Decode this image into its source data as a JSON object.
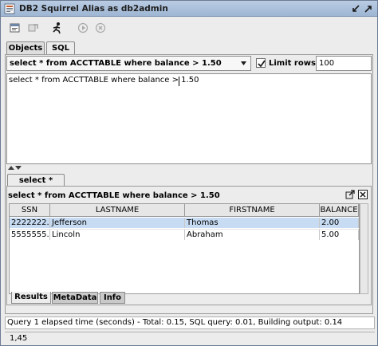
{
  "window": {
    "title": "DB2 Squirrel Alias as db2admin"
  },
  "tabs": [
    {
      "label": "Objects"
    },
    {
      "label": "SQL"
    }
  ],
  "sql_panel": {
    "history_selected": "select * from ACCTTABLE where balance > 1.50",
    "limit_rows_label": "Limit rows:",
    "limit_rows_checked": true,
    "limit_rows_value": "100",
    "editor_text": "select * from ACCTTABLE where balance > 1.50"
  },
  "result": {
    "tab_label": "select * from A",
    "query_label": "select * from ACCTTABLE where balance > 1.50",
    "columns": [
      "SSN",
      "LASTNAME",
      "FIRSTNAME",
      "BALANCE"
    ],
    "rows": [
      [
        "2222222...",
        "Jefferson",
        "Thomas",
        "2.00"
      ],
      [
        "5555555...",
        "Lincoln",
        "Abraham",
        "5.00"
      ]
    ],
    "bottom_tabs": [
      "Results",
      "MetaData",
      "Info"
    ]
  },
  "status": {
    "message": "Query 1 elapsed time (seconds) - Total: 0.15, SQL query: 0.01, Building output: 0.14",
    "position": "1,45"
  },
  "icons": {
    "app": "squirrel-app-icon",
    "titlebar": [
      "minimize-icon",
      "maximize-icon"
    ],
    "toolbar": [
      "copy-script-icon",
      "refresh-icon",
      "run-icon",
      "execute-icon",
      "stop-icon"
    ]
  },
  "colors": {
    "titlebar": "#a8bfdc",
    "selected_row": "#c7dcf3"
  }
}
